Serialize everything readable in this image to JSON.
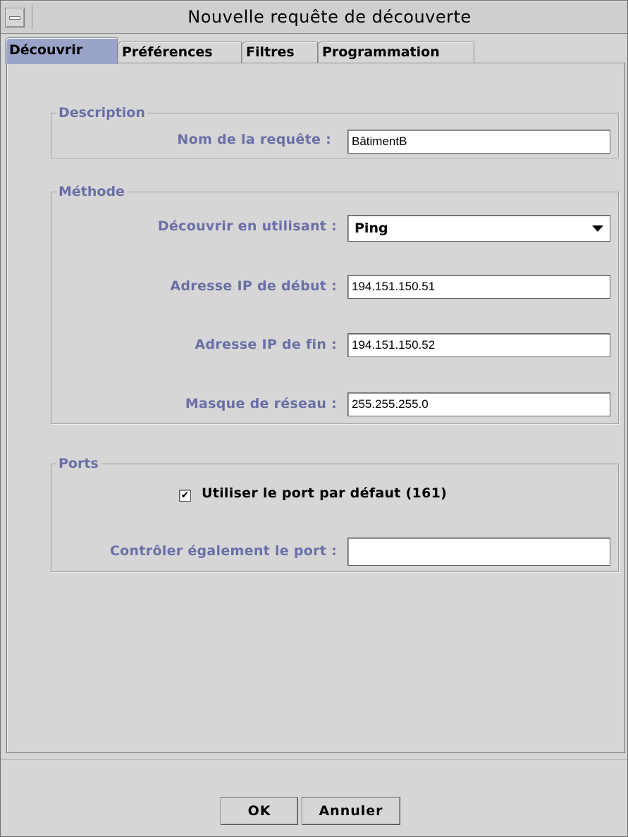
{
  "window": {
    "title": "Nouvelle requête de découverte"
  },
  "tabs": [
    {
      "label": "Découvrir",
      "active": true
    },
    {
      "label": "Préférences",
      "active": false
    },
    {
      "label": "Filtres",
      "active": false
    },
    {
      "label": "Programmation",
      "active": false
    }
  ],
  "description": {
    "legend": "Description",
    "query_name_label": "Nom de la requête :",
    "query_name_value": "BâtimentB"
  },
  "method": {
    "legend": "Méthode",
    "discover_using_label": "Découvrir en utilisant :",
    "discover_using_value": "Ping",
    "start_ip_label": "Adresse IP de début :",
    "start_ip_value": "194.151.150.51",
    "end_ip_label": "Adresse IP de fin :",
    "end_ip_value": "194.151.150.52",
    "netmask_label": "Masque de réseau :",
    "netmask_value": "255.255.255.0"
  },
  "ports": {
    "legend": "Ports",
    "use_default_label": "Utiliser le port par défaut (161)",
    "use_default_checked": true,
    "also_check_label": "Contrôler également le port :",
    "also_check_value": ""
  },
  "buttons": {
    "ok": "OK",
    "cancel": "Annuler"
  },
  "colors": {
    "label": "#6a6fa6",
    "active_tab": "#9aa4c8",
    "background": "#d6d6d6"
  }
}
